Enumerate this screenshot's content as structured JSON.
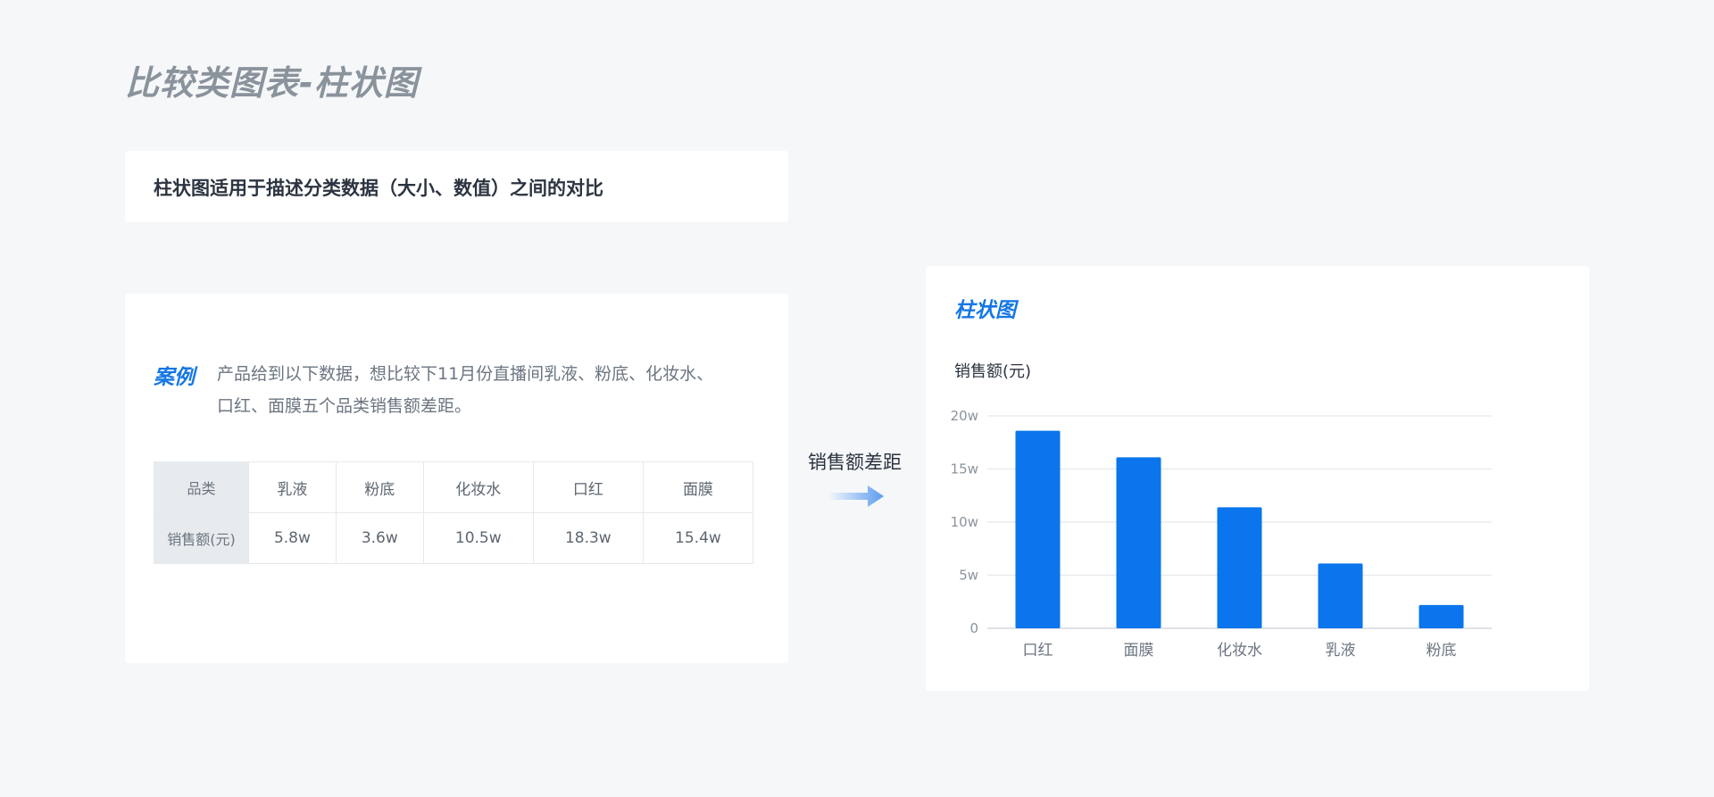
{
  "page": {
    "title": "比较类图表-柱状图"
  },
  "description": {
    "text": "柱状图适用于描述分类数据（大小、数值）之间的对比"
  },
  "case": {
    "label": "案例",
    "text": "产品给到以下数据，想比较下11月份直播间乳液、粉底、化妆水、口红、面膜五个品类销售额差距。",
    "table": {
      "header_label": "品类",
      "value_label": "销售额(元)",
      "categories": [
        "乳液",
        "粉底",
        "化妆水",
        "口红",
        "面膜"
      ],
      "values": [
        "5.8w",
        "3.6w",
        "10.5w",
        "18.3w",
        "15.4w"
      ]
    }
  },
  "arrow": {
    "label": "销售额差距",
    "color": "#5b9cf0"
  },
  "colors": {
    "accent": "#1677e5",
    "bar": "#0a75ec"
  },
  "chart_data": {
    "type": "bar",
    "title": "柱状图",
    "ylabel": "销售额(元)",
    "xlabel": "",
    "categories": [
      "口红",
      "面膜",
      "化妆水",
      "乳液",
      "粉底"
    ],
    "values": [
      18.6,
      16.1,
      11.4,
      6.1,
      2.2
    ],
    "ylim": [
      0,
      20
    ],
    "yticks": [
      0,
      5,
      10,
      15,
      20
    ],
    "ytick_labels": [
      "0",
      "5w",
      "10w",
      "15w",
      "20w"
    ],
    "grid": true,
    "legend": "none"
  }
}
